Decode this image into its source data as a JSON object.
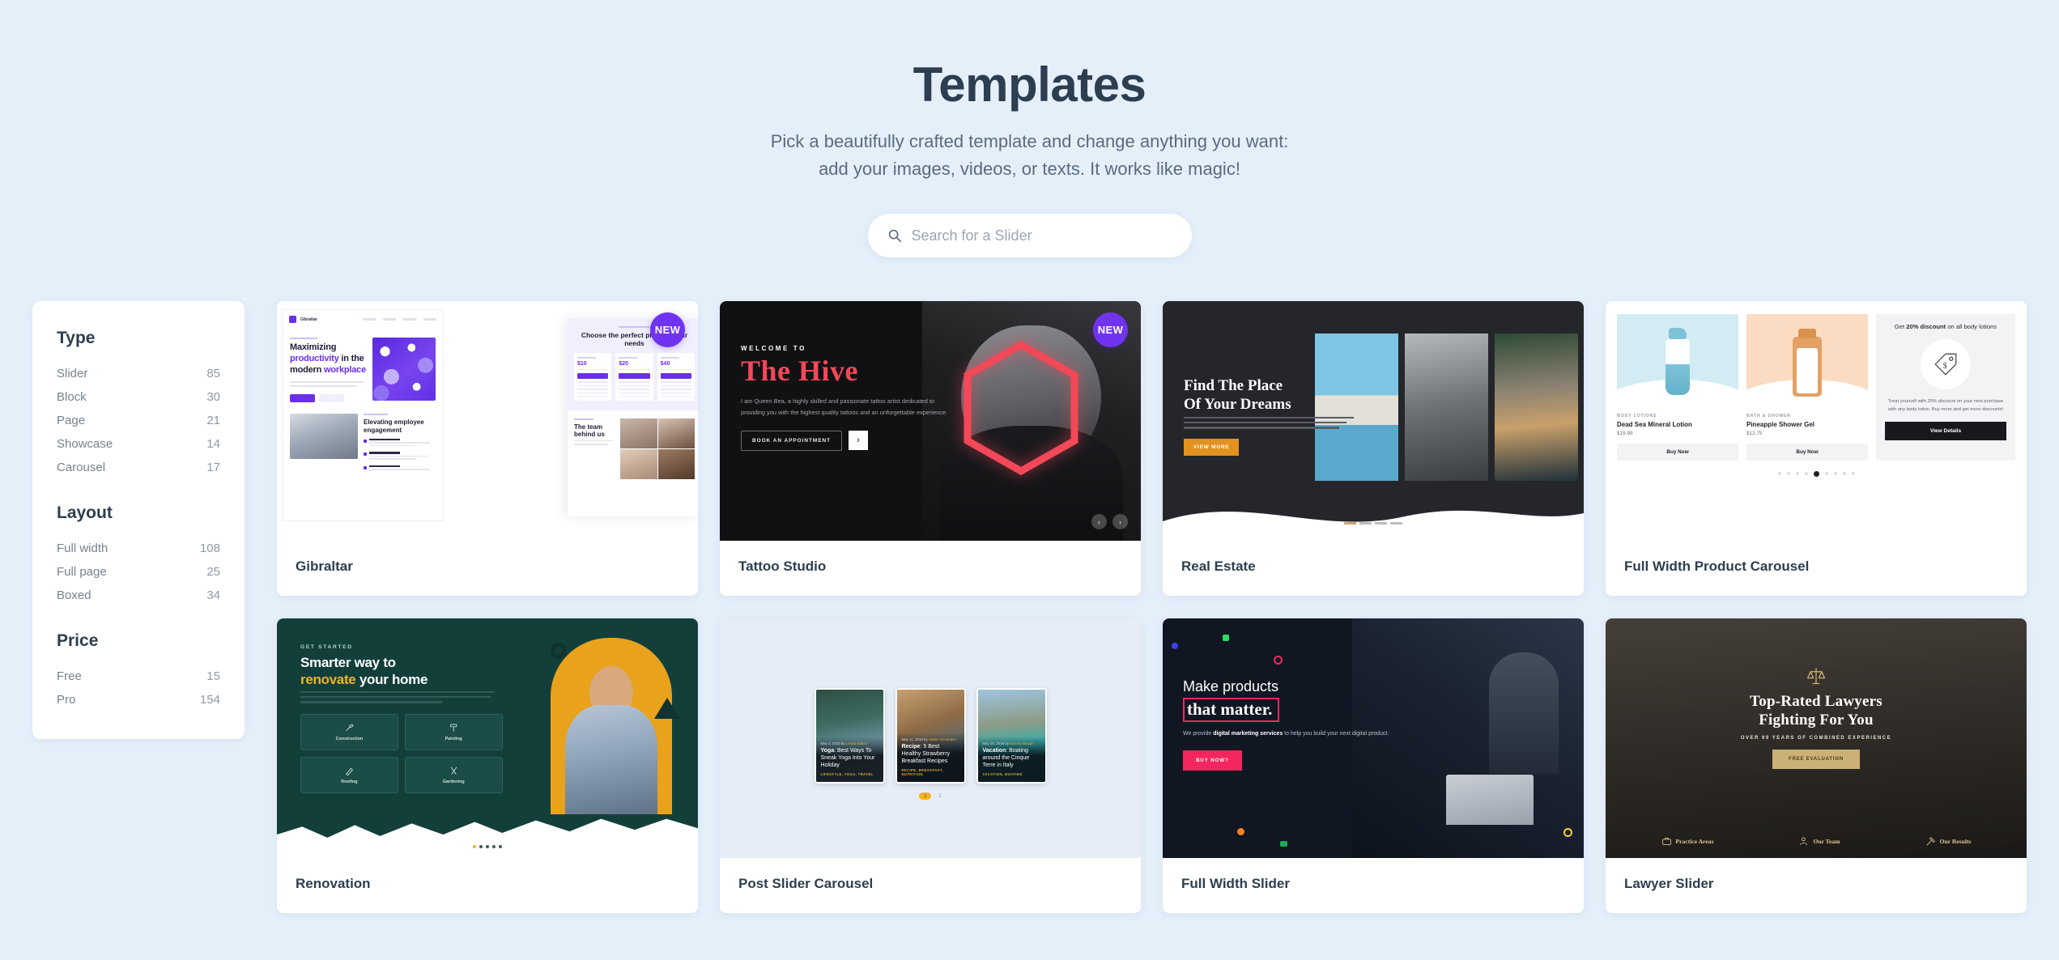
{
  "header": {
    "title": "Templates",
    "subtitle_line1": "Pick a beautifully crafted template and change anything you want:",
    "subtitle_line2": "add your images, videos, or texts. It works like magic!"
  },
  "search": {
    "placeholder": "Search for a Slider",
    "value": "",
    "icon": "search-icon"
  },
  "sidebar": {
    "groups": [
      {
        "title": "Type",
        "items": [
          {
            "label": "Slider",
            "count": "85"
          },
          {
            "label": "Block",
            "count": "30"
          },
          {
            "label": "Page",
            "count": "21"
          },
          {
            "label": "Showcase",
            "count": "14"
          },
          {
            "label": "Carousel",
            "count": "17"
          }
        ]
      },
      {
        "title": "Layout",
        "items": [
          {
            "label": "Full width",
            "count": "108"
          },
          {
            "label": "Full page",
            "count": "25"
          },
          {
            "label": "Boxed",
            "count": "34"
          }
        ]
      },
      {
        "title": "Price",
        "items": [
          {
            "label": "Free",
            "count": "15"
          },
          {
            "label": "Pro",
            "count": "154"
          }
        ]
      }
    ]
  },
  "colors": {
    "page_background": "#e4effa",
    "badge_new": "#7033f0",
    "heading": "#2c3e50",
    "tattoo_accent": "#f24858",
    "real_estate_accent": "#e2921e",
    "renovation_accent": "#f0b323",
    "slider_accent": "#f4265f",
    "lawyer_accent": "#ccb176"
  },
  "cards": [
    {
      "name": "Gibraltar",
      "badge": "NEW",
      "preview": {
        "logo": "Gibraltar",
        "headline_1": "Maximizing",
        "headline_2": "productivity",
        "headline_2b": " in the",
        "headline_3": "modern ",
        "headline_3b": "workplace",
        "section2_heading": "Elevating employee engagement",
        "pricing_heading": "Choose the perfect plan for your needs",
        "plans": [
          {
            "price": "$10"
          },
          {
            "price": "$20"
          },
          {
            "price": "$40"
          }
        ],
        "team_heading": "The team behind us"
      }
    },
    {
      "name": "Tattoo Studio",
      "badge": "NEW",
      "preview": {
        "eyebrow": "WELCOME TO",
        "headline": "The Hive",
        "body": "I am Queen Bea, a highly skilled and passionate tattoo artist dedicated to providing you with the highest quality tattoos and an unforgettable experience.",
        "cta": "BOOK AN APPOINTMENT",
        "arrow": "›",
        "nav_prev": "‹",
        "nav_next": "›"
      }
    },
    {
      "name": "Real Estate",
      "badge": "",
      "preview": {
        "headline_1": "Find The Place",
        "headline_2": "Of Your Dreams",
        "cta": "VIEW MORE",
        "dots_total": 4,
        "dots_active": 1
      }
    },
    {
      "name": "Full Width Product Carousel",
      "badge": "",
      "preview": {
        "products": [
          {
            "category": "BODY LOTIONS",
            "name": "Dead Sea Mineral Lotion",
            "price": "$19.99",
            "cta": "Buy Now"
          },
          {
            "category": "BATH & SHOWER",
            "name": "Pineapple Shower Gel",
            "price": "$12.75",
            "cta": "Buy Now"
          }
        ],
        "promo_prefix": "Get ",
        "promo_bold": "20% discount",
        "promo_suffix": " on all body lotions",
        "promo_body": "Treat yourself with 20% discount on your next purchase with any body lotion. Buy more and get more discounts!",
        "promo_cta": "View Details",
        "dots_total": 9,
        "dots_active": 5
      }
    },
    {
      "name": "Renovation",
      "badge": "",
      "preview": {
        "eyebrow": "GET STARTED",
        "headline_1": "Smarter way to",
        "headline_2a": "renovate",
        "headline_2b": " your home",
        "tiles": [
          {
            "label": "Construction",
            "icon": "hammer-icon"
          },
          {
            "label": "Painting",
            "icon": "paint-roller-icon"
          },
          {
            "label": "Roofing",
            "icon": "brush-icon"
          },
          {
            "label": "Gardening",
            "icon": "shears-icon"
          }
        ],
        "dots_total": 5,
        "dots_active": 1
      }
    },
    {
      "name": "Post Slider Carousel",
      "badge": "",
      "preview": {
        "posts": [
          {
            "meta_date": "May 2, 2018 by ",
            "meta_author": "Letizia Bolton",
            "title_bold": "Yoga",
            "title_rest": ": Best Ways To Sneak Yoga Into Your Holiday",
            "tags": "LIFESTYLE, YOGA, TRAVEL"
          },
          {
            "meta_date": "May 11, 2018 by ",
            "meta_author": "Sadie Hernandez",
            "title_bold": "Recipe",
            "title_rest": ": 5 Best Healthy Strawberry Breakfast Recipes",
            "tags": "RECIPE, BREAKFAST, NUTRITION"
          },
          {
            "meta_date": "May 26, 2018 by ",
            "meta_author": "Dennis Stewart",
            "title_bold": "Vacation",
            "title_rest": ": Boating around the Cinque Terre in Italy",
            "tags": "VACATION, BOATING"
          }
        ],
        "page_current": "1",
        "page_next": "2"
      }
    },
    {
      "name": "Full Width Slider",
      "badge": "",
      "preview": {
        "headline_1": "Make products",
        "headline_2": "that matter.",
        "body_1": "We provide ",
        "body_bold": "digital marketing services",
        "body_2": " to help you build your next digital product.",
        "cta": "BUY NOW?"
      }
    },
    {
      "name": "Lawyer Slider",
      "badge": "",
      "preview": {
        "headline_1": "Top-Rated Lawyers",
        "headline_2": "Fighting For You",
        "subtitle": "OVER 99 YEARS OF COMBINED EXPERIENCE",
        "cta": "FREE EVALUATION",
        "nav": [
          {
            "label": "Practice Areas",
            "icon": "briefcase-icon"
          },
          {
            "label": "Our Team",
            "icon": "people-icon"
          },
          {
            "label": "Our Results",
            "icon": "gavel-icon"
          }
        ]
      }
    }
  ]
}
